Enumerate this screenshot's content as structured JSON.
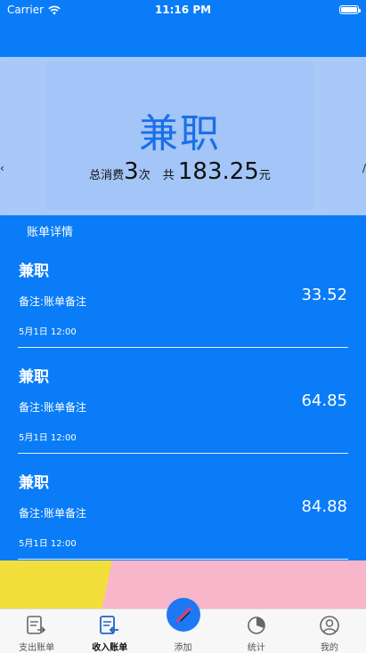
{
  "status_bar": {
    "carrier": "Carrier",
    "time": "11:16 PM"
  },
  "banner": {
    "title": "兼职",
    "total_label": "总消费",
    "count": "3",
    "count_unit": "次",
    "sum_label": "共",
    "sum": "183.25",
    "sum_unit": "元",
    "left_arrow": "‹",
    "right_arrow": "/"
  },
  "section_title": "账单详情",
  "bills": [
    {
      "category": "兼职",
      "note": "备注:账单备注",
      "amount": "33.52",
      "time": "5月1日 12:00"
    },
    {
      "category": "兼职",
      "note": "备注:账单备注",
      "amount": "64.85",
      "time": "5月1日 12:00"
    },
    {
      "category": "兼职",
      "note": "备注:账单备注",
      "amount": "84.88",
      "time": "5月1日 12:00"
    }
  ],
  "tab_bar": {
    "tabs": [
      {
        "label": "支出账单",
        "icon": "expense-bill-icon"
      },
      {
        "label": "收入账单",
        "icon": "income-bill-icon"
      },
      {
        "label": "添加",
        "icon": "add-pen-icon"
      },
      {
        "label": "统计",
        "icon": "pie-chart-icon"
      },
      {
        "label": "我的",
        "icon": "user-profile-icon"
      }
    ],
    "active_index": 1
  },
  "colors": {
    "primary": "#0a7cf7",
    "banner_bg": "#a9c9f8",
    "banner_title": "#1a6fe8",
    "tab_bar_bg": "#f7f7f7"
  }
}
